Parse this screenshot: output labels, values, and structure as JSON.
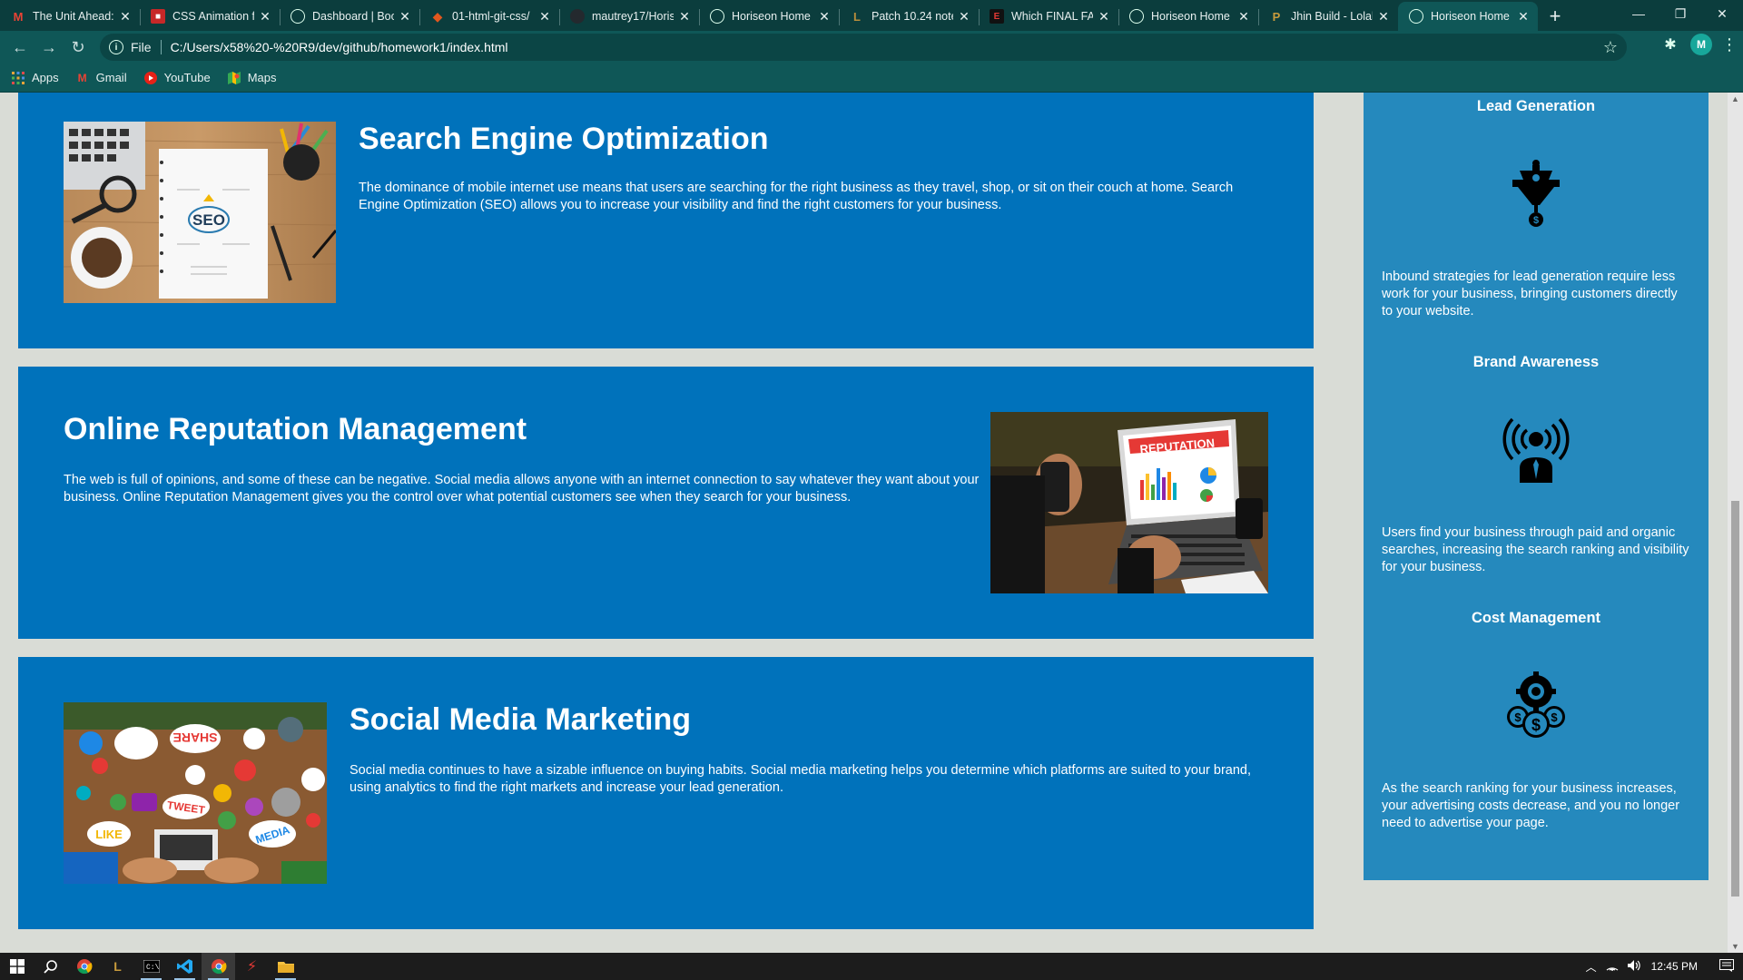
{
  "browser": {
    "tabs": [
      {
        "title": "The Unit Ahead:",
        "fav": "M",
        "fav_color": "#ea4335",
        "active": false
      },
      {
        "title": "CSS Animation fo",
        "fav": "■",
        "fav_color": "#c62828",
        "active": false
      },
      {
        "title": "Dashboard | Boo",
        "fav": "◎",
        "fav_color": "#3d6e6e",
        "active": false
      },
      {
        "title": "01-html-git-css/",
        "fav": "◆",
        "fav_color": "#e2571e",
        "active": false
      },
      {
        "title": "mautrey17/Horis",
        "fav": "●",
        "fav_color": "#24292e",
        "active": false
      },
      {
        "title": "Horiseon Home",
        "fav": "◎",
        "fav_color": "#3d6e6e",
        "active": false
      },
      {
        "title": "Patch 10.24 note",
        "fav": "L",
        "fav_color": "#b88d3c",
        "active": false
      },
      {
        "title": "Which FINAL FA",
        "fav": "E",
        "fav_color": "#111111",
        "active": false
      },
      {
        "title": "Horiseon Home",
        "fav": "◎",
        "fav_color": "#3d6e6e",
        "active": false
      },
      {
        "title": "Jhin Build - Lolal",
        "fav": "P",
        "fav_color": "#c89b3c",
        "active": false
      },
      {
        "title": "Horiseon Home",
        "fav": "◎",
        "fav_color": "#3d6e6e",
        "active": true
      }
    ],
    "scheme": "File",
    "url": "C:/Users/x58%20-%20R9/dev/github/homework1/index.html",
    "avatar": "M",
    "bookmarks": [
      {
        "label": "Apps",
        "icon": "apps-grid-icon"
      },
      {
        "label": "Gmail",
        "icon": "gmail-icon"
      },
      {
        "label": "YouTube",
        "icon": "youtube-icon"
      },
      {
        "label": "Maps",
        "icon": "maps-icon"
      }
    ]
  },
  "page": {
    "cards": [
      {
        "title": "Search Engine Optimization",
        "text": "The dominance of mobile internet use means that users are searching for the right business as they travel, shop, or sit on their couch at home. Search Engine Optimization (SEO) allows you to increase your visibility and find the right customers for your business."
      },
      {
        "title": "Online Reputation Management",
        "text": "The web is full of opinions, and some of these can be negative. Social media allows anyone with an internet connection to say whatever they want about your business. Online Reputation Management gives you the control over what potential customers see when they search for your business."
      },
      {
        "title": "Social Media Marketing",
        "text": "Social media continues to have a sizable influence on buying habits. Social media marketing helps you determine which platforms are suited to your brand, using analytics to find the right markets and increase your lead generation."
      }
    ],
    "benefits": [
      {
        "title": "Lead Generation",
        "icon": "lead-generation-icon",
        "text": "Inbound strategies for lead generation require less work for your business, bringing customers directly to your website."
      },
      {
        "title": "Brand Awareness",
        "icon": "brand-awareness-icon",
        "text": "Users find your business through paid and organic searches, increasing the search ranking and visibility for your business."
      },
      {
        "title": "Cost Management",
        "icon": "cost-management-icon",
        "text": "As the search ranking for your business increases, your advertising costs decrease, and you no longer need to advertise your page."
      }
    ],
    "image_labels": {
      "seo": "SEO",
      "reputation": "REPUTATION",
      "social": [
        "SHARE",
        "TWEET",
        "LIKE",
        "MEDIA"
      ]
    }
  },
  "taskbar": {
    "time": "12:45 PM"
  },
  "colors": {
    "card": "#0072bb",
    "aside": "#2589bd",
    "page_bg": "#d9dcd6",
    "chrome": "#0f5757"
  }
}
